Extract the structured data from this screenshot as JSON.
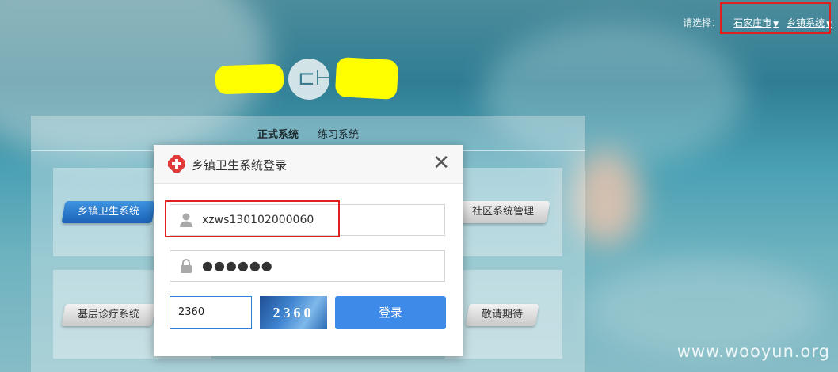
{
  "topbar": {
    "prompt": "请选择：",
    "city": "石家庄市",
    "system": "乡镇系统"
  },
  "tabs": {
    "formal": "正式系统",
    "practice": "练习系统"
  },
  "systems": {
    "township": "乡镇卫生系统",
    "community": "社区系统管理",
    "clinic": "基层诊疗系统",
    "coming": "敬请期待"
  },
  "dialog": {
    "title": "乡镇卫生系统登录",
    "username": "xzws130102000060",
    "password_mask": "●●●●●●",
    "captcha_input": "2360",
    "captcha_image_text": "2360",
    "login_label": "登录"
  },
  "watermark": "www.wooyun.org",
  "colors": {
    "accent": "#3d8ae8",
    "highlight": "#e0201f",
    "redaction": "#ffff00"
  }
}
